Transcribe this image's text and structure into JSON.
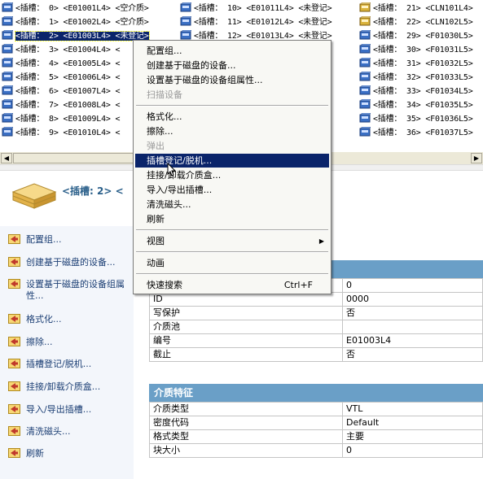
{
  "slots": [
    {
      "col": 0,
      "row": 0,
      "label": "<插槽：  0> <E01001L4> <空介质>"
    },
    {
      "col": 0,
      "row": 1,
      "label": "<插槽：  1> <E01002L4> <空介质>"
    },
    {
      "col": 0,
      "row": 2,
      "label": "<插槽：  2> <E01003L4> <未登记>",
      "selected": true
    },
    {
      "col": 0,
      "row": 3,
      "label": "<插槽：  3> <E01004L4> <"
    },
    {
      "col": 0,
      "row": 4,
      "label": "<插槽：  4> <E01005L4> <"
    },
    {
      "col": 0,
      "row": 5,
      "label": "<插槽：  5> <E01006L4> <"
    },
    {
      "col": 0,
      "row": 6,
      "label": "<插槽：  6> <E01007L4> <"
    },
    {
      "col": 0,
      "row": 7,
      "label": "<插槽：  7> <E01008L4> <"
    },
    {
      "col": 0,
      "row": 8,
      "label": "<插槽：  8> <E01009L4> <"
    },
    {
      "col": 0,
      "row": 9,
      "label": "<插槽：  9> <E01010L4> <"
    },
    {
      "col": 1,
      "row": 0,
      "label": "<插槽： 10> <E01011L4> <未登记>"
    },
    {
      "col": 1,
      "row": 1,
      "label": "<插槽： 11> <E01012L4> <未登记>"
    },
    {
      "col": 1,
      "row": 2,
      "label": "<插槽： 12> <E01013L4> <未登记>"
    },
    {
      "col": 2,
      "row": 0,
      "label": "<插槽： 21> <CLN101L4>"
    },
    {
      "col": 2,
      "row": 1,
      "label": "<插槽： 22> <CLN102L5>"
    },
    {
      "col": 2,
      "row": 2,
      "label": "<插槽： 29> <F01030L5>"
    },
    {
      "col": 2,
      "row": 3,
      "label": "<插槽： 30> <F01031L5>"
    },
    {
      "col": 2,
      "row": 4,
      "label": "<插槽： 31> <F01032L5>"
    },
    {
      "col": 2,
      "row": 5,
      "label": "<插槽： 32> <F01033L5>"
    },
    {
      "col": 2,
      "row": 6,
      "label": "<插槽： 33> <F01034L5>"
    },
    {
      "col": 2,
      "row": 7,
      "label": "<插槽： 34> <F01035L5>"
    },
    {
      "col": 2,
      "row": 8,
      "label": "<插槽： 35> <F01036L5>"
    },
    {
      "col": 2,
      "row": 9,
      "label": "<插槽： 36> <F01037L5>"
    }
  ],
  "context_menu": [
    {
      "label": "配置组..."
    },
    {
      "label": "创建基于磁盘的设备..."
    },
    {
      "label": "设置基于磁盘的设备组属性..."
    },
    {
      "label": "扫描设备",
      "disabled": true
    },
    {
      "sep": true
    },
    {
      "label": "格式化..."
    },
    {
      "label": "擦除..."
    },
    {
      "label": "弹出",
      "disabled": true
    },
    {
      "label": "插槽登记/脱机...",
      "highlighted": true
    },
    {
      "label": "挂接/卸载介质盒..."
    },
    {
      "label": "导入/导出插槽..."
    },
    {
      "label": "清洗磁头..."
    },
    {
      "label": "刷新"
    },
    {
      "sep": true
    },
    {
      "label": "视图",
      "submenu": true
    },
    {
      "sep": true
    },
    {
      "label": "动画"
    },
    {
      "sep": true
    },
    {
      "label": "快速搜索",
      "shortcut": "Ctrl+F"
    }
  ],
  "detail": {
    "title": "<插槽: 2> <",
    "tasks": [
      "配置组...",
      "创建基于磁盘的设备...",
      "设置基于磁盘的设备组属性...",
      "格式化...",
      "擦除...",
      "插槽登记/脱机...",
      "挂接/卸载介质盒...",
      "导入/导出插槽...",
      "清洗磁头...",
      "刷新"
    ],
    "general_props": [
      {
        "key": "",
        "value": "0"
      },
      {
        "key": "ID",
        "value": "0000"
      },
      {
        "key": "写保护",
        "value": "否"
      },
      {
        "key": "介质池",
        "value": ""
      },
      {
        "key": "编号",
        "value": "E01003L4"
      },
      {
        "key": "截止",
        "value": "否"
      }
    ],
    "media_section_title": "介质特征",
    "media_props": [
      {
        "key": "介质类型",
        "value": "VTL"
      },
      {
        "key": "密度代码",
        "value": "Default"
      },
      {
        "key": "格式类型",
        "value": "主要"
      },
      {
        "key": "块大小",
        "value": "0"
      }
    ]
  },
  "colors": {
    "selection": "#0a246a",
    "section_header": "#6a9fc7",
    "task_panel_bg": "#f3f6fb",
    "task_link": "#1b3e74"
  },
  "icons": {
    "slot": "tape-cartridge-icon",
    "cleaning_slot": "cleaning-tape-icon",
    "header": "tape-stack-icon",
    "task": "arrow-task-icon"
  }
}
